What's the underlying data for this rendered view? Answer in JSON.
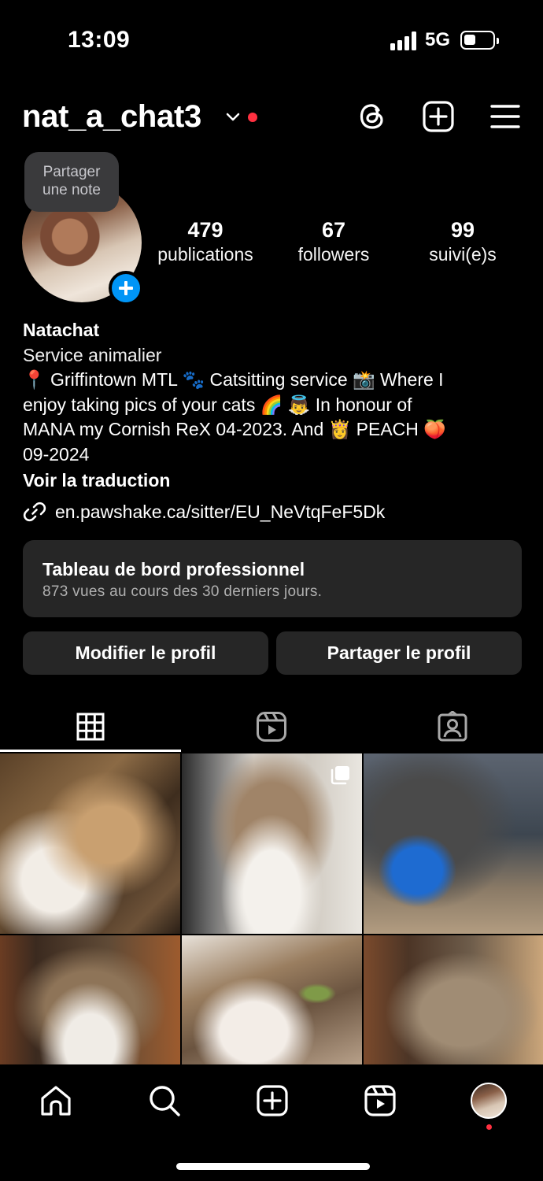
{
  "status_bar": {
    "time": "13:09",
    "network": "5G"
  },
  "header": {
    "username": "nat_a_chat3"
  },
  "note_bubble": {
    "line1": "Partager",
    "line2": "une note"
  },
  "stats": [
    {
      "value": "479",
      "label": "publications"
    },
    {
      "value": "67",
      "label": "followers"
    },
    {
      "value": "99",
      "label": "suivi(e)s"
    }
  ],
  "bio": {
    "name": "Natachat",
    "category": "Service animalier",
    "lines": [
      "📍 Griffintown MTL 🐾 Catsitting service 📸 Where I",
      "enjoy taking pics of your cats 🌈 👼 In honour of",
      "MANA my Cornish ReX 04-2023. And 👸 PEACH 🍑",
      "09-2024"
    ],
    "translation": "Voir la traduction",
    "link": "en.pawshake.ca/sitter/EU_NeVtqFeF5Dk"
  },
  "dashboard": {
    "title": "Tableau de bord professionnel",
    "subtitle": "873 vues au cours des 30 derniers jours."
  },
  "buttons": {
    "edit": "Modifier le profil",
    "share": "Partager le profil"
  },
  "tabs": [
    "grid",
    "reels",
    "tagged"
  ],
  "colors": {
    "accent": "#0095f6",
    "notification": "#ff3040",
    "card": "#262626"
  }
}
